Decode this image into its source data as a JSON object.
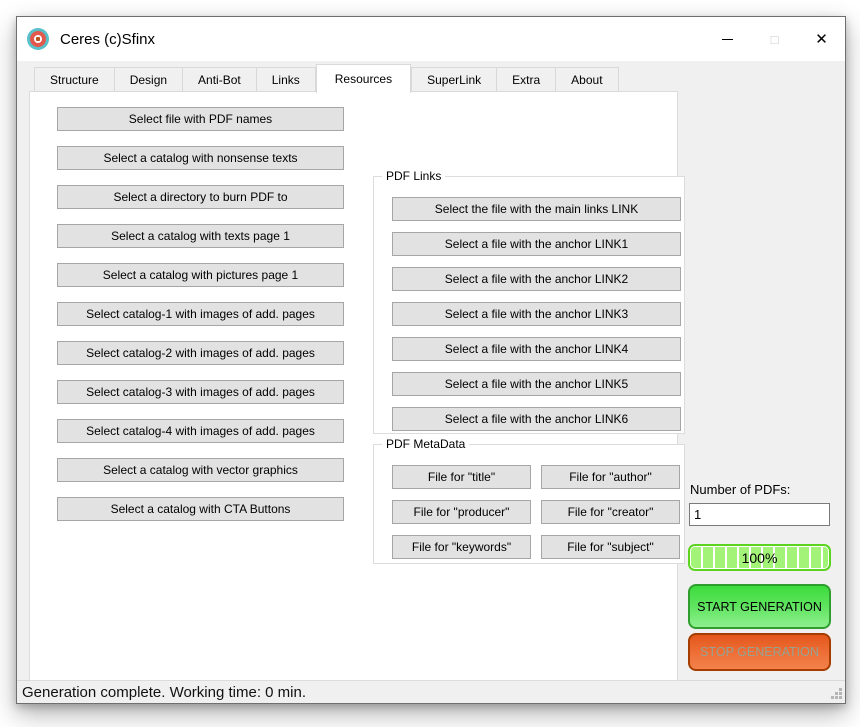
{
  "window": {
    "title": "Ceres (c)Sfinx",
    "controls": {
      "minimize": "",
      "maximize": "□",
      "close": "✕"
    }
  },
  "tabs": {
    "active": "Resources",
    "items": [
      "Structure",
      "Design",
      "Anti-Bot",
      "Links",
      "Resources",
      "SuperLink",
      "Extra",
      "About"
    ]
  },
  "left_buttons": [
    "Select file with PDF names",
    "Select a catalog with nonsense texts",
    "Select a directory to burn PDF to",
    "Select a catalog with texts page 1",
    "Select a catalog with pictures page 1",
    "Select catalog-1 with images of add. pages",
    "Select catalog-2 with images of add. pages",
    "Select catalog-3 with images of add. pages",
    "Select catalog-4 with images of add. pages",
    "Select a catalog with vector graphics",
    "Select a catalog with CTA Buttons"
  ],
  "pdf_links": {
    "title": "PDF Links",
    "buttons": [
      "Select the file with the main links LINK",
      "Select a file with the anchor LINK1",
      "Select a file with the anchor LINK2",
      "Select a file with the anchor LINK3",
      "Select a file with the anchor LINK4",
      "Select a file with the anchor LINK5",
      "Select a file with the anchor LINK6"
    ]
  },
  "pdf_metadata": {
    "title": "PDF MetaData",
    "buttons": [
      "File for \"title\"",
      "File for \"author\"",
      "File for \"producer\"",
      "File for \"creator\"",
      "File for \"keywords\"",
      "File for \"subject\""
    ]
  },
  "generation": {
    "number_label": "Number of PDFs:",
    "number_value": "1",
    "progress_text": "100%",
    "start_label": "START GENERATION",
    "stop_label": "STOP GENERATION"
  },
  "status_bar": {
    "text": "Generation complete. Working time: 0 min."
  },
  "colors": {
    "progress_fill": "#a3f378",
    "progress_border": "#5cd41f",
    "start_green": "#3cdc3c",
    "start_border": "#2f9e2f",
    "stop_orange": "#e4571b",
    "stop_border": "#a63d00",
    "titlebar_bg": "#ffffff",
    "client_bg": "#f0f0f0"
  }
}
